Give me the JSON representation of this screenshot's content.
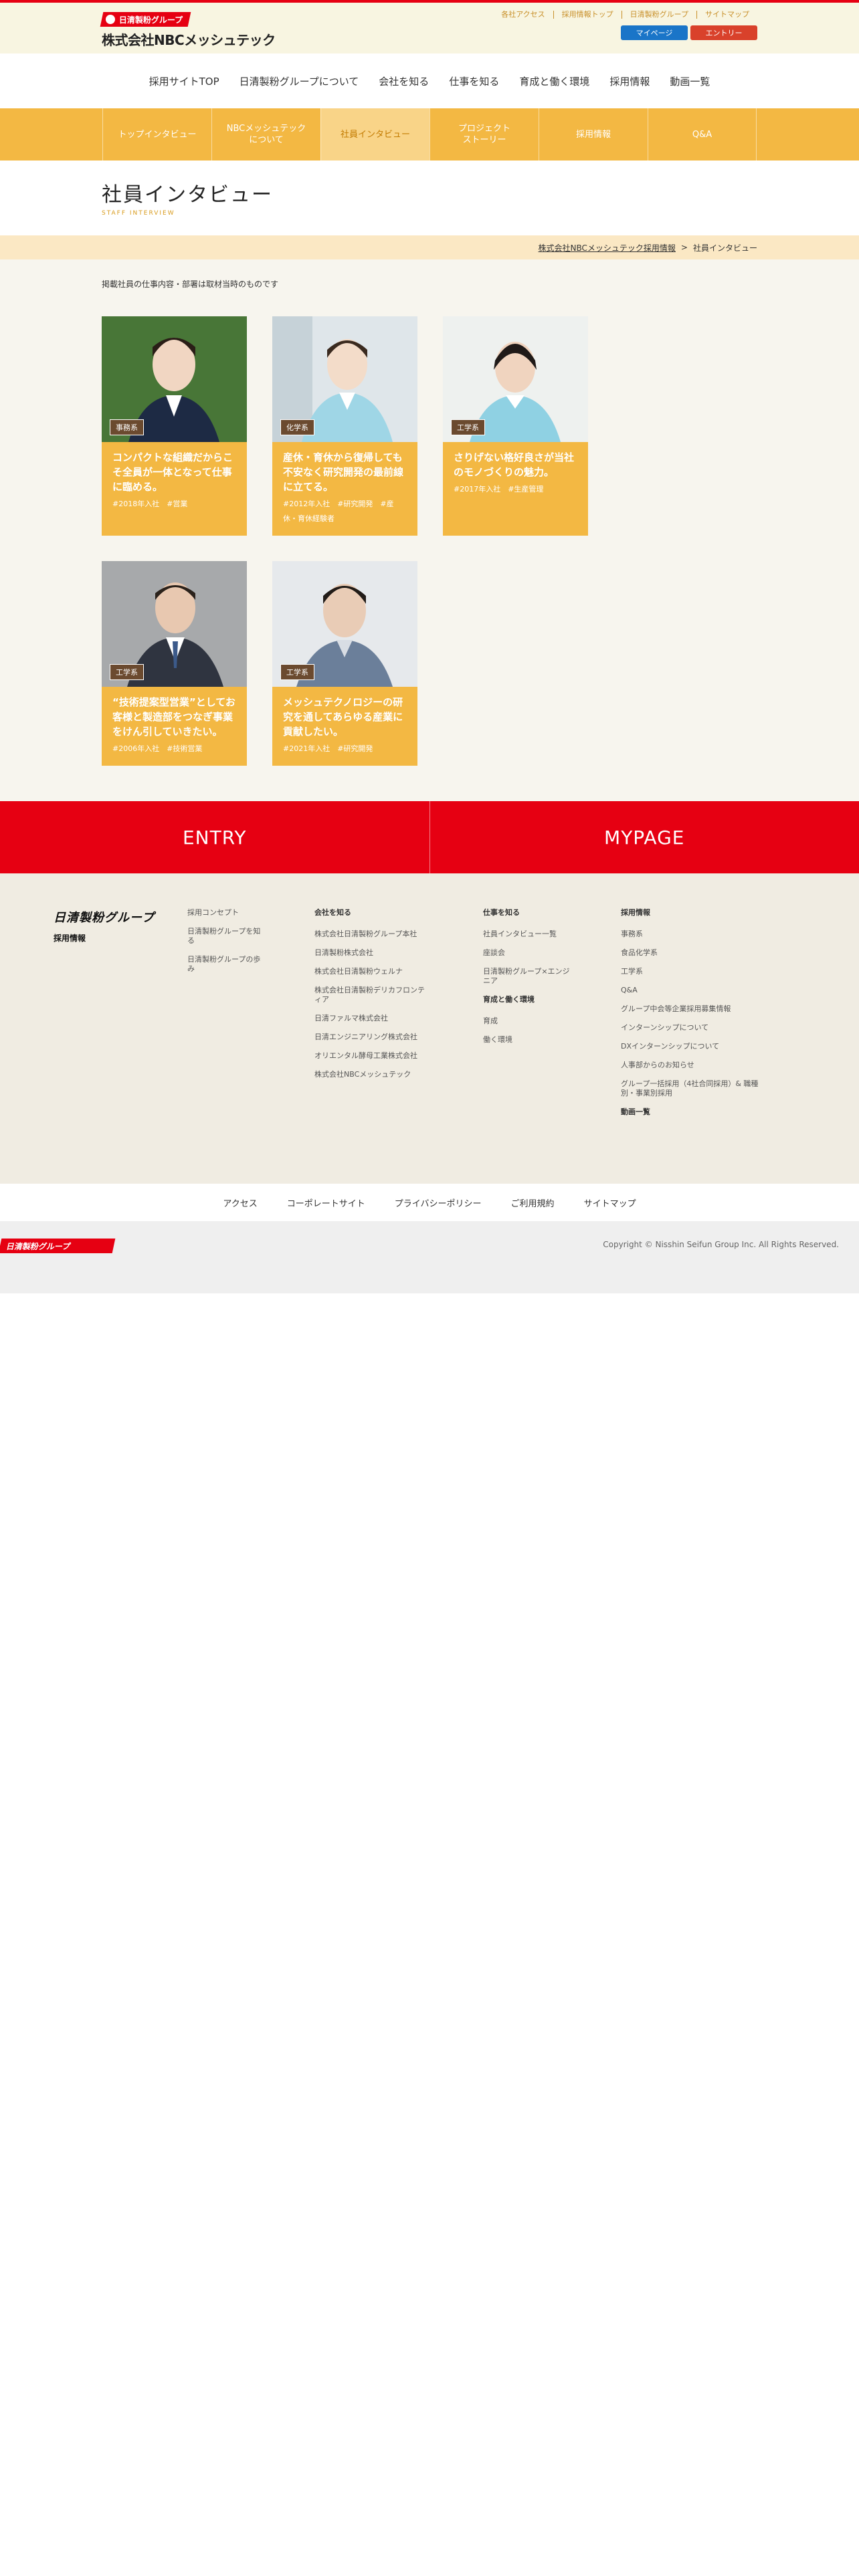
{
  "header": {
    "brand_badge": "日清製粉グループ",
    "company": "株式会社NBCメッシュテック",
    "utility_links": [
      "各社アクセス",
      "採用情報トップ",
      "日清製粉グループ",
      "サイトマップ"
    ],
    "mypage": "マイページ",
    "entry": "エントリー"
  },
  "main_nav": [
    "採用サイトTOP",
    "日清製粉グループについて",
    "会社を知る",
    "仕事を知る",
    "育成と働く環境",
    "採用情報",
    "動画一覧"
  ],
  "sub_nav": [
    "トップインタビュー",
    "NBCメッシュテック\nについて",
    "社員インタビュー",
    "プロジェクト\nストーリー",
    "採用情報",
    "Q&A"
  ],
  "page": {
    "title": "社員インタビュー",
    "title_en": "STAFF INTERVIEW"
  },
  "breadcrumb": {
    "home": "株式会社NBCメッシュテック採用情報",
    "sep": ">",
    "current": "社員インタビュー"
  },
  "note": "掲載社員の仕事内容・部署は取材当時のものです",
  "cards": [
    {
      "tag": "事務系",
      "title": "コンパクトな組織だからこそ全員が一体となって仕事に臨める。",
      "meta": "#2018年入社　#営業"
    },
    {
      "tag": "化学系",
      "title": "産休・育休から復帰しても不安なく研究開発の最前線に立てる。",
      "meta": "#2012年入社　#研究開発　#産休・育休経験者"
    },
    {
      "tag": "工学系",
      "title": "さりげない格好良さが当社のモノづくりの魅力。",
      "meta": "#2017年入社　#生産管理"
    },
    {
      "tag": "工学系",
      "title": "“技術提案型営業”としてお客様と製造部をつなぎ事業をけん引していきたい。",
      "meta": "#2006年入社　#技術営業"
    },
    {
      "tag": "工学系",
      "title": "メッシュテクノロジーの研究を通してあらゆる産業に貢献したい。",
      "meta": "#2021年入社　#研究開発"
    }
  ],
  "cta": {
    "entry": "ENTRY",
    "mypage": "MYPAGE"
  },
  "footer": {
    "logo": "日清製粉グループ",
    "logo_sub": "採用情報",
    "col1": [
      "採用コンセプト",
      "日清製粉グループを知る",
      "日清製粉グループの歩み"
    ],
    "col2_head": "会社を知る",
    "col2": [
      "株式会社日清製粉グループ本社",
      "日清製粉株式会社",
      "株式会社日清製粉ウェルナ",
      "株式会社日清製粉デリカフロンティア",
      "日清ファルマ株式会社",
      "日清エンジニアリング株式会社",
      "オリエンタル酵母工業株式会社",
      "株式会社NBCメッシュテック"
    ],
    "col3_head": "仕事を知る",
    "col3": [
      "社員インタビュー一覧",
      "座談会",
      "日清製粉グループ×エンジニア"
    ],
    "col3_head2": "育成と働く環境",
    "col3b": [
      "育成",
      "働く環境"
    ],
    "col4_head": "採用情報",
    "col4": [
      "事務系",
      "食品化学系",
      "工学系",
      "Q&A",
      "グループ中会等企業採用募集情報",
      "インターンシップについて",
      "DXインターンシップについて",
      "人事部からのお知らせ",
      "グループ一括採用（4社合同採用）& 職種別・事業別採用"
    ],
    "col4_tail": "動画一覧"
  },
  "legal": [
    "アクセス",
    "コーポレートサイト",
    "プライバシーポリシー",
    "ご利用規約",
    "サイトマップ"
  ],
  "copyright": "Copyright © Nisshin Seifun Group Inc. All Rights Reserved."
}
